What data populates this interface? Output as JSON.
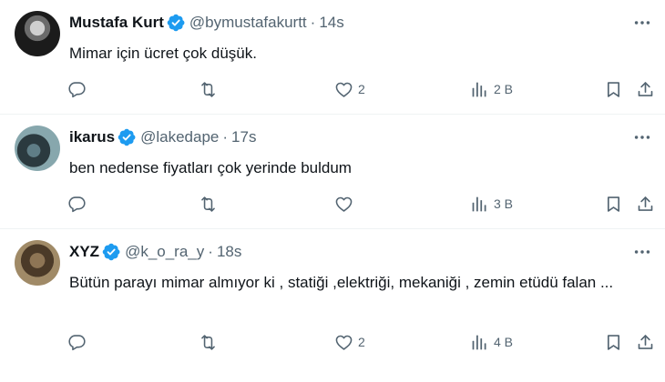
{
  "tweets": [
    {
      "name": "Mustafa Kurt",
      "handle": "@bymustafakurtt",
      "separator": "·",
      "time": "14s",
      "text": "Mimar için ücret çok düşük.",
      "replies": "",
      "retweets": "",
      "likes": "2",
      "views": "2 B"
    },
    {
      "name": "ikarus",
      "handle": "@lakedape",
      "separator": "·",
      "time": "17s",
      "text": "ben nedense fiyatları çok yerinde buldum",
      "replies": "",
      "retweets": "",
      "likes": "",
      "views": "3 B"
    },
    {
      "name": "XYZ",
      "handle": "@k_o_ra_y",
      "separator": "·",
      "time": "18s",
      "text": "Bütün parayı mimar almıyor ki , statiği ,elektriği, mekaniği , zemin etüdü falan ...",
      "replies": "",
      "retweets": "",
      "likes": "2",
      "views": "4 B"
    }
  ],
  "icons": {
    "verified": "verified-badge-icon",
    "more": "more-icon",
    "reply": "reply-icon",
    "retweet": "retweet-icon",
    "like": "heart-icon",
    "views": "views-icon",
    "bookmark": "bookmark-icon",
    "share": "share-icon"
  },
  "colors": {
    "verified": "#1d9bf0",
    "text": "#0f1419",
    "secondary": "#536471",
    "divider": "#eff3f4"
  }
}
